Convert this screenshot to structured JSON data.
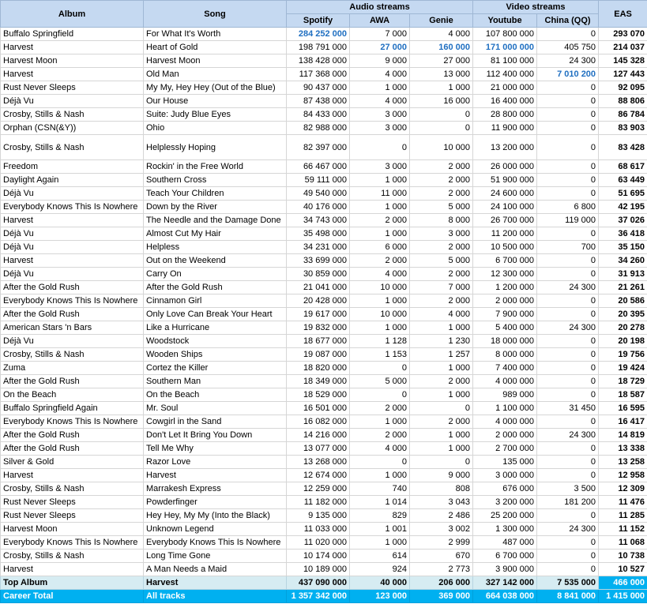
{
  "headers": {
    "album": "Album",
    "song": "Song",
    "audio": "Audio streams",
    "video": "Video streams",
    "eas": "EAS",
    "spotify": "Spotify",
    "awa": "AWA",
    "genie": "Genie",
    "youtube": "Youtube",
    "china": "China (QQ)"
  },
  "rows": [
    {
      "album": "Buffalo Springfield",
      "song": "For What It's Worth",
      "spotify": "284 252 000",
      "awa": "7 000",
      "genie": "4 000",
      "youtube": "107 800 000",
      "china": "0",
      "eas": "293 070",
      "hl": [
        "spotify"
      ]
    },
    {
      "album": "Harvest",
      "song": "Heart of Gold",
      "spotify": "198 791 000",
      "awa": "27 000",
      "genie": "160 000",
      "youtube": "171 000 000",
      "china": "405 750",
      "eas": "214 037",
      "hl": [
        "awa",
        "genie",
        "youtube"
      ]
    },
    {
      "album": "Harvest Moon",
      "song": "Harvest Moon",
      "spotify": "138 428 000",
      "awa": "9 000",
      "genie": "27 000",
      "youtube": "81 100 000",
      "china": "24 300",
      "eas": "145 328",
      "hl": []
    },
    {
      "album": "Harvest",
      "song": "Old Man",
      "spotify": "117 368 000",
      "awa": "4 000",
      "genie": "13 000",
      "youtube": "112 400 000",
      "china": "7 010 200",
      "eas": "127 443",
      "hl": [
        "china"
      ]
    },
    {
      "album": "Rust Never Sleeps",
      "song": "My My, Hey Hey (Out of the Blue)",
      "spotify": "90 437 000",
      "awa": "1 000",
      "genie": "1 000",
      "youtube": "21 000 000",
      "china": "0",
      "eas": "92 095",
      "hl": []
    },
    {
      "album": "Déjà Vu",
      "song": "Our House",
      "spotify": "87 438 000",
      "awa": "4 000",
      "genie": "16 000",
      "youtube": "16 400 000",
      "china": "0",
      "eas": "88 806",
      "hl": []
    },
    {
      "album": "Crosby, Stills & Nash",
      "song": "Suite: Judy Blue Eyes",
      "spotify": "84 433 000",
      "awa": "3 000",
      "genie": "0",
      "youtube": "28 800 000",
      "china": "0",
      "eas": "86 784",
      "hl": []
    },
    {
      "album": "Orphan (CSN(&Y))",
      "song": "Ohio",
      "spotify": "82 988 000",
      "awa": "3 000",
      "genie": "0",
      "youtube": "11 900 000",
      "china": "0",
      "eas": "83 903",
      "hl": []
    },
    {
      "album": "Crosby, Stills & Nash",
      "song": "Helplessly Hoping",
      "spotify": "82 397 000",
      "awa": "0",
      "genie": "10 000",
      "youtube": "13 200 000",
      "china": "0",
      "eas": "83 428",
      "hl": [],
      "tall": true
    },
    {
      "album": "Freedom",
      "song": "Rockin' in the Free World",
      "spotify": "66 467 000",
      "awa": "3 000",
      "genie": "2 000",
      "youtube": "26 000 000",
      "china": "0",
      "eas": "68 617",
      "hl": []
    },
    {
      "album": "Daylight Again",
      "song": "Southern Cross",
      "spotify": "59 111 000",
      "awa": "1 000",
      "genie": "2 000",
      "youtube": "51 900 000",
      "china": "0",
      "eas": "63 449",
      "hl": []
    },
    {
      "album": "Déjà Vu",
      "song": "Teach Your Children",
      "spotify": "49 540 000",
      "awa": "11 000",
      "genie": "2 000",
      "youtube": "24 600 000",
      "china": "0",
      "eas": "51 695",
      "hl": []
    },
    {
      "album": "Everybody Knows This Is Nowhere",
      "song": "Down by the River",
      "spotify": "40 176 000",
      "awa": "1 000",
      "genie": "5 000",
      "youtube": "24 100 000",
      "china": "6 800",
      "eas": "42 195",
      "hl": []
    },
    {
      "album": "Harvest",
      "song": "The Needle and the Damage Done",
      "spotify": "34 743 000",
      "awa": "2 000",
      "genie": "8 000",
      "youtube": "26 700 000",
      "china": "119 000",
      "eas": "37 026",
      "hl": []
    },
    {
      "album": "Déjà Vu",
      "song": "Almost Cut My Hair",
      "spotify": "35 498 000",
      "awa": "1 000",
      "genie": "3 000",
      "youtube": "11 200 000",
      "china": "0",
      "eas": "36 418",
      "hl": []
    },
    {
      "album": "Déjà Vu",
      "song": "Helpless",
      "spotify": "34 231 000",
      "awa": "6 000",
      "genie": "2 000",
      "youtube": "10 500 000",
      "china": "700",
      "eas": "35 150",
      "hl": []
    },
    {
      "album": "Harvest",
      "song": "Out on the Weekend",
      "spotify": "33 699 000",
      "awa": "2 000",
      "genie": "5 000",
      "youtube": "6 700 000",
      "china": "0",
      "eas": "34 260",
      "hl": []
    },
    {
      "album": "Déjà Vu",
      "song": "Carry On",
      "spotify": "30 859 000",
      "awa": "4 000",
      "genie": "2 000",
      "youtube": "12 300 000",
      "china": "0",
      "eas": "31 913",
      "hl": []
    },
    {
      "album": "After the Gold Rush",
      "song": "After the Gold Rush",
      "spotify": "21 041 000",
      "awa": "10 000",
      "genie": "7 000",
      "youtube": "1 200 000",
      "china": "24 300",
      "eas": "21 261",
      "hl": []
    },
    {
      "album": "Everybody Knows This Is Nowhere",
      "song": "Cinnamon Girl",
      "spotify": "20 428 000",
      "awa": "1 000",
      "genie": "2 000",
      "youtube": "2 000 000",
      "china": "0",
      "eas": "20 586",
      "hl": []
    },
    {
      "album": "After the Gold Rush",
      "song": "Only Love Can Break Your Heart",
      "spotify": "19 617 000",
      "awa": "10 000",
      "genie": "4 000",
      "youtube": "7 900 000",
      "china": "0",
      "eas": "20 395",
      "hl": []
    },
    {
      "album": "American Stars 'n Bars",
      "song": "Like a Hurricane",
      "spotify": "19 832 000",
      "awa": "1 000",
      "genie": "1 000",
      "youtube": "5 400 000",
      "china": "24 300",
      "eas": "20 278",
      "hl": []
    },
    {
      "album": "Déjà Vu",
      "song": "Woodstock",
      "spotify": "18 677 000",
      "awa": "1 128",
      "genie": "1 230",
      "youtube": "18 000 000",
      "china": "0",
      "eas": "20 198",
      "hl": []
    },
    {
      "album": "Crosby, Stills & Nash",
      "song": "Wooden Ships",
      "spotify": "19 087 000",
      "awa": "1 153",
      "genie": "1 257",
      "youtube": "8 000 000",
      "china": "0",
      "eas": "19 756",
      "hl": []
    },
    {
      "album": "Zuma",
      "song": "Cortez the Killer",
      "spotify": "18 820 000",
      "awa": "0",
      "genie": "1 000",
      "youtube": "7 400 000",
      "china": "0",
      "eas": "19 424",
      "hl": []
    },
    {
      "album": "After the Gold Rush",
      "song": "Southern Man",
      "spotify": "18 349 000",
      "awa": "5 000",
      "genie": "2 000",
      "youtube": "4 000 000",
      "china": "0",
      "eas": "18 729",
      "hl": []
    },
    {
      "album": "On the Beach",
      "song": "On the Beach",
      "spotify": "18 529 000",
      "awa": "0",
      "genie": "1 000",
      "youtube": "989 000",
      "china": "0",
      "eas": "18 587",
      "hl": []
    },
    {
      "album": "Buffalo Springfield Again",
      "song": "Mr. Soul",
      "spotify": "16 501 000",
      "awa": "2 000",
      "genie": "0",
      "youtube": "1 100 000",
      "china": "31 450",
      "eas": "16 595",
      "hl": []
    },
    {
      "album": "Everybody Knows This Is Nowhere",
      "song": "Cowgirl in the Sand",
      "spotify": "16 082 000",
      "awa": "1 000",
      "genie": "2 000",
      "youtube": "4 000 000",
      "china": "0",
      "eas": "16 417",
      "hl": []
    },
    {
      "album": "After the Gold Rush",
      "song": "Don't Let It Bring You Down",
      "spotify": "14 216 000",
      "awa": "2 000",
      "genie": "1 000",
      "youtube": "2 000 000",
      "china": "24 300",
      "eas": "14 819",
      "hl": []
    },
    {
      "album": "After the Gold Rush",
      "song": "Tell Me Why",
      "spotify": "13 077 000",
      "awa": "4 000",
      "genie": "1 000",
      "youtube": "2 700 000",
      "china": "0",
      "eas": "13 338",
      "hl": []
    },
    {
      "album": "Silver & Gold",
      "song": "Razor Love",
      "spotify": "13 268 000",
      "awa": "0",
      "genie": "0",
      "youtube": "135 000",
      "china": "0",
      "eas": "13 258",
      "hl": []
    },
    {
      "album": "Harvest",
      "song": "Harvest",
      "spotify": "12 674 000",
      "awa": "1 000",
      "genie": "9 000",
      "youtube": "3 000 000",
      "china": "0",
      "eas": "12 958",
      "hl": []
    },
    {
      "album": "Crosby, Stills & Nash",
      "song": "Marrakesh Express",
      "spotify": "12 259 000",
      "awa": "740",
      "genie": "808",
      "youtube": "676 000",
      "china": "3 500",
      "eas": "12 309",
      "hl": []
    },
    {
      "album": "Rust Never Sleeps",
      "song": "Powderfinger",
      "spotify": "11 182 000",
      "awa": "1 014",
      "genie": "3 043",
      "youtube": "3 200 000",
      "china": "181 200",
      "eas": "11 476",
      "hl": []
    },
    {
      "album": "Rust Never Sleeps",
      "song": "Hey Hey, My My (Into the Black)",
      "spotify": "9 135 000",
      "awa": "829",
      "genie": "2 486",
      "youtube": "25 200 000",
      "china": "0",
      "eas": "11 285",
      "hl": []
    },
    {
      "album": "Harvest Moon",
      "song": "Unknown Legend",
      "spotify": "11 033 000",
      "awa": "1 001",
      "genie": "3 002",
      "youtube": "1 300 000",
      "china": "24 300",
      "eas": "11 152",
      "hl": []
    },
    {
      "album": "Everybody Knows This Is Nowhere",
      "song": "Everybody Knows This Is Nowhere",
      "spotify": "11 020 000",
      "awa": "1 000",
      "genie": "2 999",
      "youtube": "487 000",
      "china": "0",
      "eas": "11 068",
      "hl": []
    },
    {
      "album": "Crosby, Stills & Nash",
      "song": "Long Time Gone",
      "spotify": "10 174 000",
      "awa": "614",
      "genie": "670",
      "youtube": "6 700 000",
      "china": "0",
      "eas": "10 738",
      "hl": []
    },
    {
      "album": "Harvest",
      "song": "A Man Needs a Maid",
      "spotify": "10 189 000",
      "awa": "924",
      "genie": "2 773",
      "youtube": "3 900 000",
      "china": "0",
      "eas": "10 527",
      "hl": []
    }
  ],
  "top": {
    "label": "Top Album",
    "album": "Harvest",
    "spotify": "437 090 000",
    "awa": "40 000",
    "genie": "206 000",
    "youtube": "327 142 000",
    "china": "7 535 000",
    "eas": "466 000"
  },
  "career": {
    "label": "Career Total",
    "album": "All tracks",
    "spotify": "1 357 342 000",
    "awa": "123 000",
    "genie": "369 000",
    "youtube": "664 038 000",
    "china": "8 841 000",
    "eas": "1 415 000"
  }
}
